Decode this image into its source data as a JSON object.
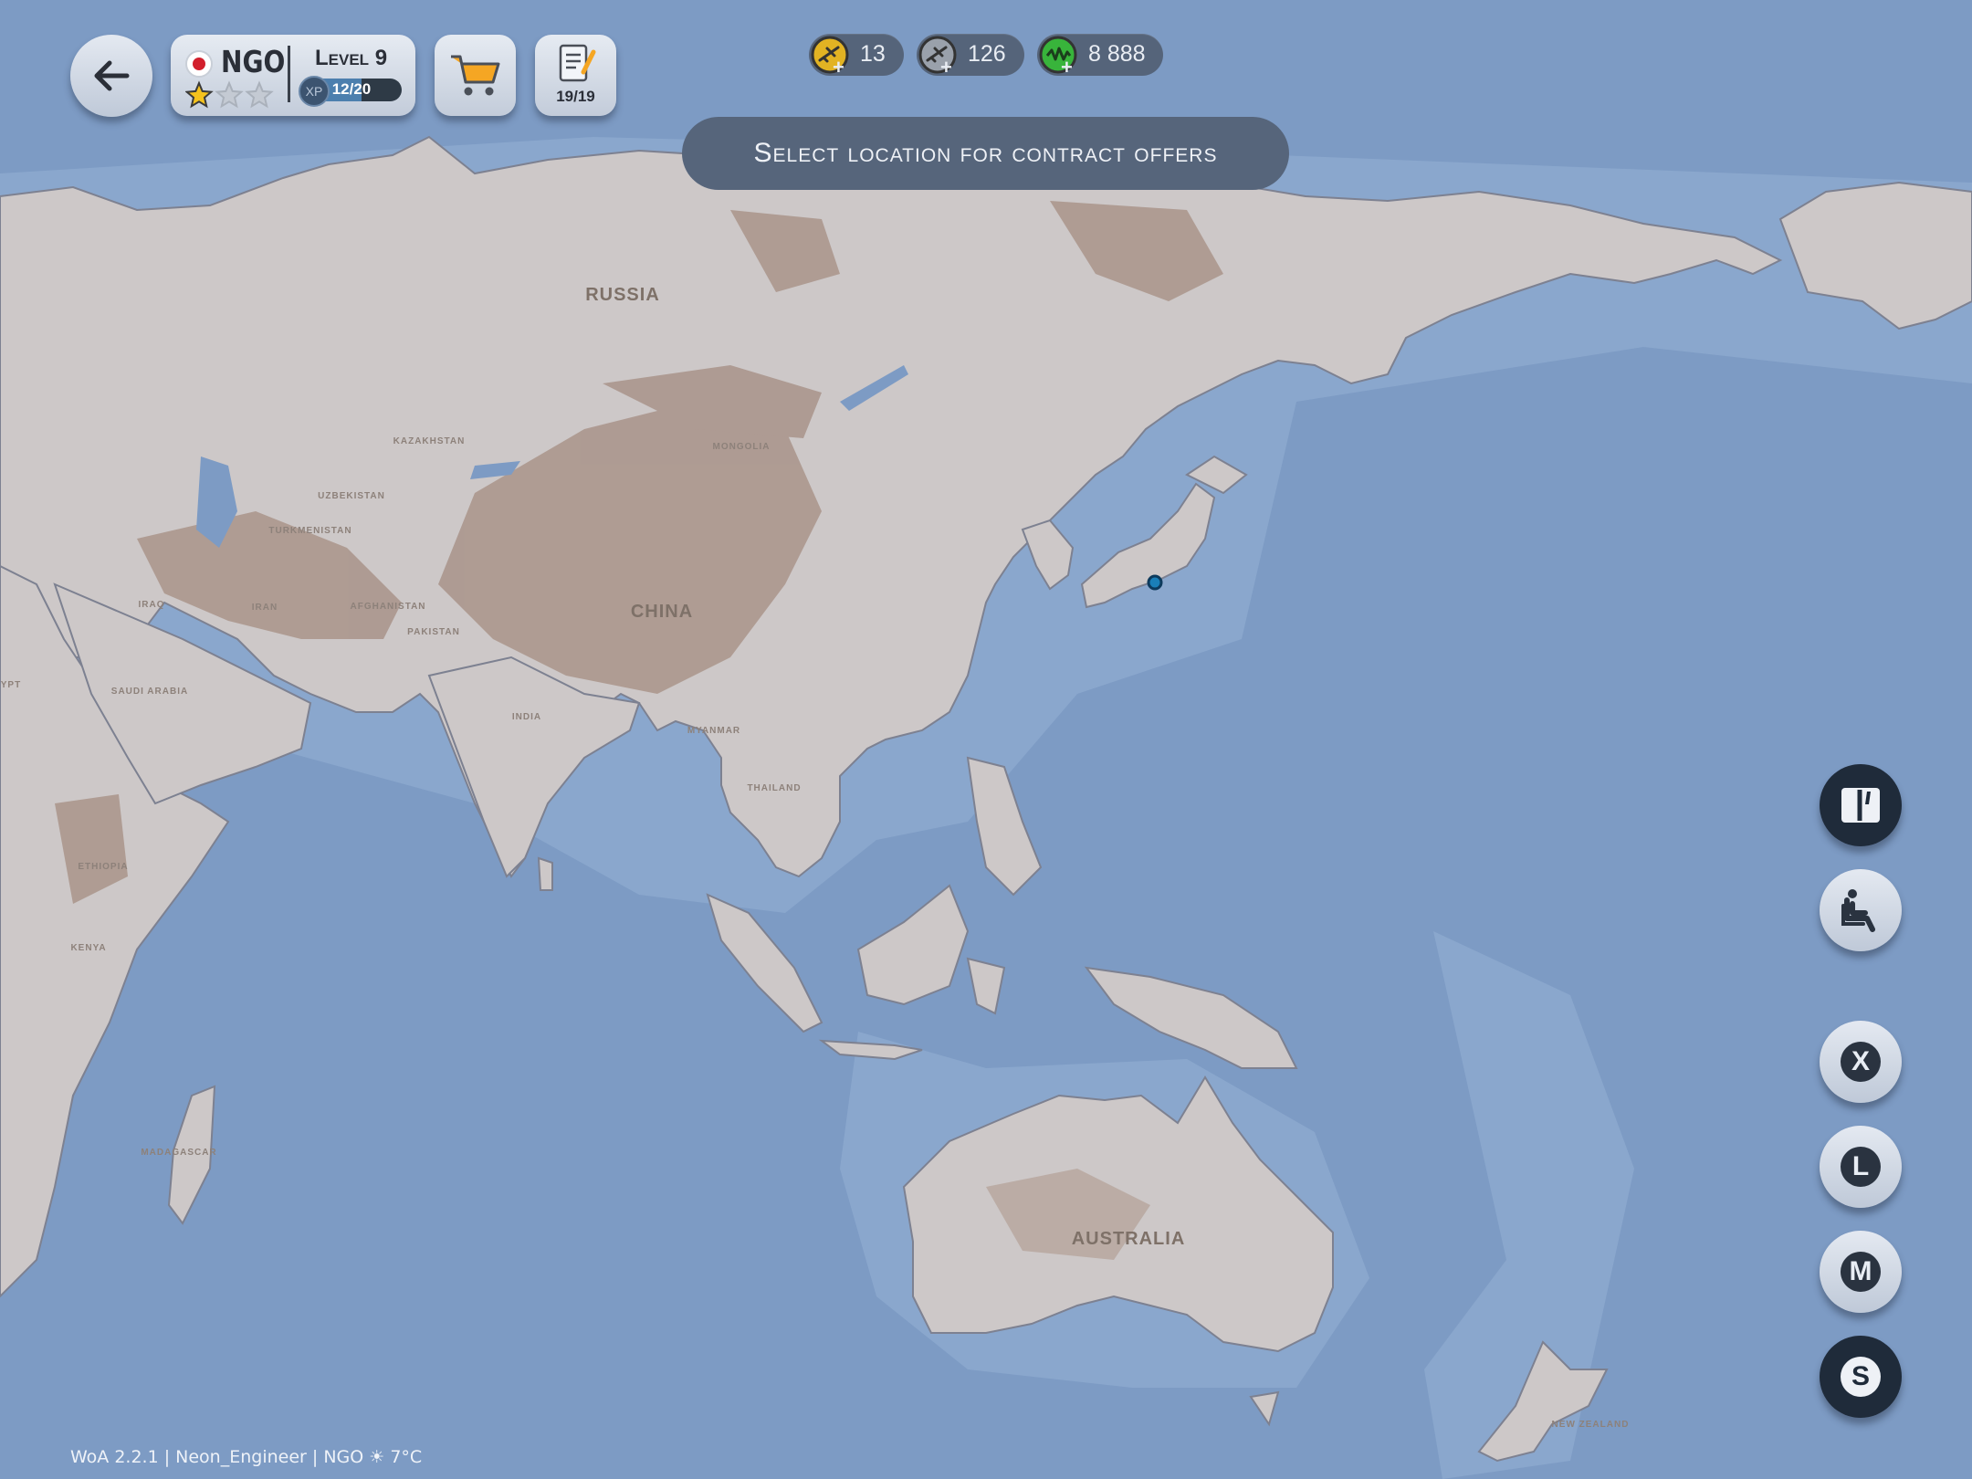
{
  "header": {
    "airport_code": "NGO",
    "level": "Level 9",
    "xp_text": "12/20",
    "xp_progress": 0.6,
    "xp_badge": "XP",
    "stars_filled": 1,
    "stars_total": 3,
    "contracts_count": "19/19"
  },
  "currencies": [
    {
      "value": "13",
      "icon": "gold-plane-coin-icon",
      "color": "#e2b323"
    },
    {
      "value": "126",
      "icon": "grey-plane-coin-icon",
      "color": "#9aa1ab"
    },
    {
      "value": "8 888",
      "icon": "green-cash-coin-icon",
      "color": "#38b43b"
    }
  ],
  "banner": "Select location for contract offers",
  "map_labels": {
    "russia": "RUSSIA",
    "china": "CHINA",
    "australia": "AUSTRALIA",
    "mongolia": "MONGOLIA",
    "kazakhstan": "KAZAKHSTAN",
    "india": "INDIA",
    "iraq": "IRAQ",
    "iran": "IRAN",
    "saudi_arabia": "SAUDI ARABIA",
    "ethiopia": "ETHIOPIA",
    "kenya": "KENYA",
    "new_zealand": "NEW ZEALAND",
    "pakistan": "PAKISTAN",
    "afghanistan": "AFGHANISTAN",
    "myanmar": "MYANMAR",
    "thailand": "THAILAND",
    "madagascar": "MADAGASCAR",
    "egypt": "YPT",
    "uzbekistan": "UZBEKISTAN",
    "turkmenistan": "TURKMENISTAN"
  },
  "side_buttons": {
    "toggle_icon": "panel-toggle-icon",
    "seat_icon": "passenger-seat-icon",
    "x": "X",
    "l": "L",
    "m": "M",
    "s": "S"
  },
  "footer": "WoA 2.2.1 | Neon_Engineer | NGO ☀ 7°C",
  "colors": {
    "ocean": "#7d9bc4",
    "land": "#cdc8c8",
    "mountains": "#a9948a",
    "hud_dark": "#1f2b3a"
  }
}
